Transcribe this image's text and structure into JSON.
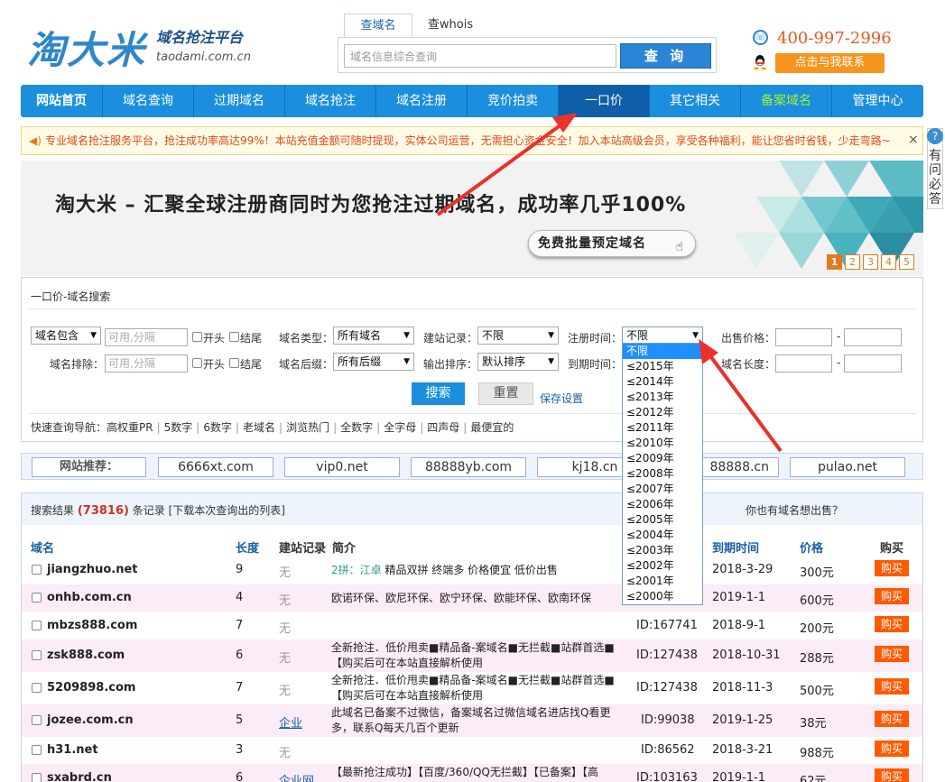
{
  "header": {
    "logo_main": "淘大米",
    "logo_sub": "域名抢注平台",
    "logo_url": "taodami.com.cn",
    "search_tabs": [
      "查域名",
      "查whois"
    ],
    "search_placeholder": "域名信息综合查询",
    "search_button": "查 询",
    "phone": "400-997-2996",
    "contact_button": "点击与我联系"
  },
  "nav": {
    "items": [
      "网站首页",
      "域名查询",
      "过期域名",
      "域名抢注",
      "域名注册",
      "竞价拍卖",
      "一口价",
      "其它相关",
      "备案域名",
      "管理中心"
    ],
    "active": "一口价"
  },
  "notice": {
    "text": "专业域名抢注服务平台，抢注成功率高达99%！本站充值金额可随时提现，实体公司运营，无需担心资金安全！加入本站高级会员，享受各种福利，能让您省时省钱，少走弯路~",
    "close": "×"
  },
  "side_help": {
    "label": "有问必答",
    "bubble": "?"
  },
  "banner": {
    "title": "淘大米 – 汇聚全球注册商同时为您抢注过期域名，成功率几乎100%",
    "button": "免费批量预定域名",
    "pages": [
      "1",
      "2",
      "3",
      "4",
      "5"
    ]
  },
  "filter": {
    "title": "一口价-域名搜索",
    "contain_select": "域名包含",
    "placeholder": "可用,分隔",
    "start_label": "开头",
    "end_label": "结尾",
    "exclude_label": "域名排除：",
    "type_label": "域名类型：",
    "type_value": "所有域名",
    "suffix_label": "域名后缀：",
    "suffix_value": "所有后缀",
    "site_label": "建站记录：",
    "site_value": "不限",
    "sort_label": "输出排序：",
    "sort_value": "默认排序",
    "regtime_label": "注册时间：",
    "regtime_value": "不限",
    "expire_label": "到期时间：",
    "price_label": "出售价格：",
    "length_label": "域名长度：",
    "dash": "-",
    "search_button": "搜索",
    "reset_button": "重置",
    "save_link": "保存设置",
    "quick_label": "快速查询导航：",
    "quick_items": [
      "高权重PR",
      "5数字",
      "6数字",
      "老域名",
      "浏览热门",
      "全数字",
      "全字母",
      "四声母",
      "最便宜的"
    ],
    "regtime_options": [
      "不限",
      "≤2015年",
      "≤2014年",
      "≤2013年",
      "≤2012年",
      "≤2011年",
      "≤2010年",
      "≤2009年",
      "≤2008年",
      "≤2007年",
      "≤2006年",
      "≤2005年",
      "≤2004年",
      "≤2003年",
      "≤2002年",
      "≤2001年",
      "≤2000年"
    ]
  },
  "recommend": {
    "label": "网站推荐：",
    "items": [
      "6666xt.com",
      "vip0.net",
      "88888yb.com",
      "kj18.cn",
      "88888.cn",
      "pulao.net"
    ]
  },
  "results": {
    "title_prefix": "搜索结果",
    "count": "(73816)",
    "title_suffix": "条记录 [下载本次查询出的列表]",
    "right_text": "你也有域名想出售？",
    "columns": {
      "domain": "域名",
      "length": "长度",
      "record": "建站记录",
      "desc": "简介",
      "expire": "到期时间",
      "price": "价格",
      "buy": "购买"
    },
    "buy_label": "购买",
    "rows": [
      {
        "domain": "jiangzhuo.net",
        "length": "9",
        "record": "无",
        "desc_pre": "2拼：江卓",
        "desc": " 精品双拼 终端多 价格便宜 低价出售",
        "id": "",
        "expire": "2018-3-29",
        "price": "300元"
      },
      {
        "domain": "onhb.com.cn",
        "length": "4",
        "record": "无",
        "desc_pre": "",
        "desc": "欧诺环保、欧尼环保、欧宁环保、欧能环保、欧南环保",
        "id": "",
        "expire": "2019-1-1",
        "price": "600元"
      },
      {
        "domain": "mbzs888.com",
        "length": "7",
        "record": "无",
        "desc_pre": "",
        "desc": "",
        "id": "ID:167741",
        "expire": "2018-9-1",
        "price": "200元"
      },
      {
        "domain": "zsk888.com",
        "length": "6",
        "record": "无",
        "desc_pre": "",
        "desc": "全新抢注．低价甩卖■精品备-案域名■无拦截■站群首选■【购买后可在本站直接解析使用",
        "id": "ID:127438",
        "expire": "2018-10-31",
        "price": "288元"
      },
      {
        "domain": "5209898.com",
        "length": "7",
        "record": "无",
        "desc_pre": "",
        "desc": "全新抢注．低价甩卖■精品备-案域名■无拦截■站群首选■【购买后可在本站直接解析使用",
        "id": "ID:127438",
        "expire": "2018-11-3",
        "price": "500元"
      },
      {
        "domain": "jozee.com.cn",
        "length": "5",
        "record": "企业",
        "desc_pre": "",
        "desc": "此域名已备案不过微信，备案域名过微信域名进店找Q看更多，联系Q每天几百个更新",
        "id": "ID:99038",
        "expire": "2019-1-25",
        "price": "38元"
      },
      {
        "domain": "h31.net",
        "length": "3",
        "record": "无",
        "desc_pre": "",
        "desc": "",
        "id": "ID:86562",
        "expire": "2018-3-21",
        "price": "988元"
      },
      {
        "domain": "sxabrd.cn",
        "length": "6",
        "record": "企业网",
        "desc_pre": "",
        "desc": "【最新抢注成功】【百度/360/QQ无拦截】【已备案】【高",
        "id": "ID:103163",
        "expire": "2019-1-1",
        "price": "62元"
      }
    ]
  }
}
